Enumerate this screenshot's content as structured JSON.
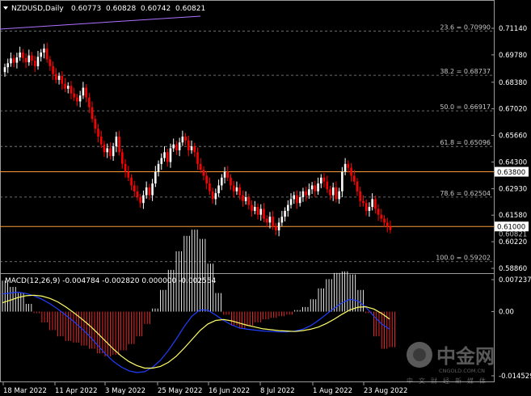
{
  "header": {
    "symbol": "NZDUSD,Daily",
    "open": "0.60773",
    "high": "0.60828",
    "low": "0.60742",
    "close": "0.60821"
  },
  "price_axis": {
    "ticks": [
      "0.71140",
      "0.69780",
      "0.68380",
      "0.67020",
      "0.65660",
      "0.64300",
      "0.62930",
      "0.61580",
      "0.60220",
      "0.58860"
    ]
  },
  "fib_levels": [
    {
      "label": "23.6 = 0.70990",
      "price": 0.7099
    },
    {
      "label": "38.2 = 0.68737",
      "price": 0.68737
    },
    {
      "label": "50.0 = 0.66917",
      "price": 0.66917
    },
    {
      "label": "61.8 = 0.65096",
      "price": 0.65096
    },
    {
      "label": "78.6 = 0.62504",
      "price": 0.62504
    },
    {
      "label": "100.0 = 0.59202",
      "price": 0.59202
    }
  ],
  "hlines": [
    {
      "label": "0.63800",
      "price": 0.638,
      "color": "#ff9933"
    },
    {
      "label": "0.61000",
      "price": 0.61,
      "color": "#ff9933"
    }
  ],
  "current_price_label": "0.60821",
  "macd": {
    "title": "MACD(12,26,9) -0.004784 -0.002820 0.000000 -0.002554",
    "axis": [
      "0.007237",
      "0.00",
      "-0.014529"
    ]
  },
  "date_axis": [
    "18 Mar 2022",
    "11 Apr 2022",
    "3 May 2022",
    "25 May 2022",
    "16 Jun 2022",
    "8 Jul 2022",
    "1 Aug 2022",
    "23 Aug 2022"
  ],
  "watermark": {
    "brand": "中金网",
    "sub": "中文财经新媒体",
    "url": "CNGOLD.COM.CN"
  },
  "colors": {
    "bull": "#ffffff",
    "bear": "#ff0000",
    "hline": "#ff9933",
    "macd_line": "#1f3fff",
    "signal_line": "#ffff66",
    "hist_pos": "#ffffff",
    "hist_neg": "#ff2a2a"
  },
  "chart_data": {
    "type": "candlestick",
    "title": "NZDUSD,Daily",
    "x_start": "18 Mar 2022",
    "closes": [
      0.6915,
      0.6935,
      0.696,
      0.6938,
      0.6965,
      0.699,
      0.6962,
      0.694,
      0.6975,
      0.6948,
      0.692,
      0.6968,
      0.699,
      0.701,
      0.6955,
      0.692,
      0.688,
      0.685,
      0.687,
      0.683,
      0.6805,
      0.682,
      0.678,
      0.676,
      0.674,
      0.677,
      0.681,
      0.676,
      0.671,
      0.665,
      0.66,
      0.656,
      0.652,
      0.648,
      0.65,
      0.646,
      0.651,
      0.656,
      0.648,
      0.642,
      0.638,
      0.635,
      0.631,
      0.628,
      0.625,
      0.622,
      0.626,
      0.63,
      0.626,
      0.632,
      0.638,
      0.642,
      0.645,
      0.648,
      0.643,
      0.65,
      0.652,
      0.649,
      0.653,
      0.656,
      0.654,
      0.649,
      0.651,
      0.648,
      0.642,
      0.639,
      0.636,
      0.632,
      0.628,
      0.624,
      0.627,
      0.631,
      0.635,
      0.638,
      0.635,
      0.631,
      0.628,
      0.63,
      0.626,
      0.623,
      0.625,
      0.621,
      0.618,
      0.62,
      0.616,
      0.619,
      0.614,
      0.612,
      0.615,
      0.61,
      0.608,
      0.612,
      0.615,
      0.618,
      0.621,
      0.624,
      0.626,
      0.622,
      0.625,
      0.628,
      0.626,
      0.629,
      0.631,
      0.628,
      0.632,
      0.635,
      0.633,
      0.629,
      0.626,
      0.63,
      0.624,
      0.628,
      0.638,
      0.642,
      0.64,
      0.636,
      0.633,
      0.628,
      0.623,
      0.622,
      0.618,
      0.62,
      0.624,
      0.619,
      0.616,
      0.614,
      0.612,
      0.61,
      0.6082
    ],
    "macd_line": [
      0.004,
      0.0042,
      0.0044,
      0.0041,
      0.0036,
      0.0028,
      0.0018,
      0.0006,
      -0.0008,
      -0.0022,
      -0.0038,
      -0.0055,
      -0.0075,
      -0.0095,
      -0.0112,
      -0.0125,
      -0.0134,
      -0.0138,
      -0.0136,
      -0.0126,
      -0.011,
      -0.0088,
      -0.0062,
      -0.0034,
      -0.001,
      0.0004,
      0.0003,
      -0.0008,
      -0.002,
      -0.003,
      -0.0037,
      -0.004,
      -0.0042,
      -0.0044,
      -0.0045,
      -0.0046,
      -0.0046,
      -0.0044,
      -0.004,
      -0.0032,
      -0.002,
      -0.0006,
      0.0008,
      0.002,
      0.0028,
      0.0024,
      0.001,
      -0.001,
      -0.0028,
      -0.004
    ],
    "signal_line": [
      0.002,
      0.0026,
      0.0032,
      0.0036,
      0.0037,
      0.0035,
      0.003,
      0.0022,
      0.0011,
      -0.0002,
      -0.0016,
      -0.0031,
      -0.0048,
      -0.0066,
      -0.0084,
      -0.01,
      -0.0113,
      -0.0122,
      -0.0128,
      -0.0128,
      -0.0124,
      -0.0115,
      -0.0101,
      -0.0083,
      -0.0063,
      -0.0043,
      -0.0028,
      -0.002,
      -0.0018,
      -0.0021,
      -0.0026,
      -0.0031,
      -0.0035,
      -0.0039,
      -0.0041,
      -0.0043,
      -0.0044,
      -0.0045,
      -0.0043,
      -0.004,
      -0.0035,
      -0.0027,
      -0.0017,
      -0.0006,
      0.0004,
      0.001,
      0.0011,
      0.0006,
      -0.0004,
      -0.0017
    ]
  }
}
